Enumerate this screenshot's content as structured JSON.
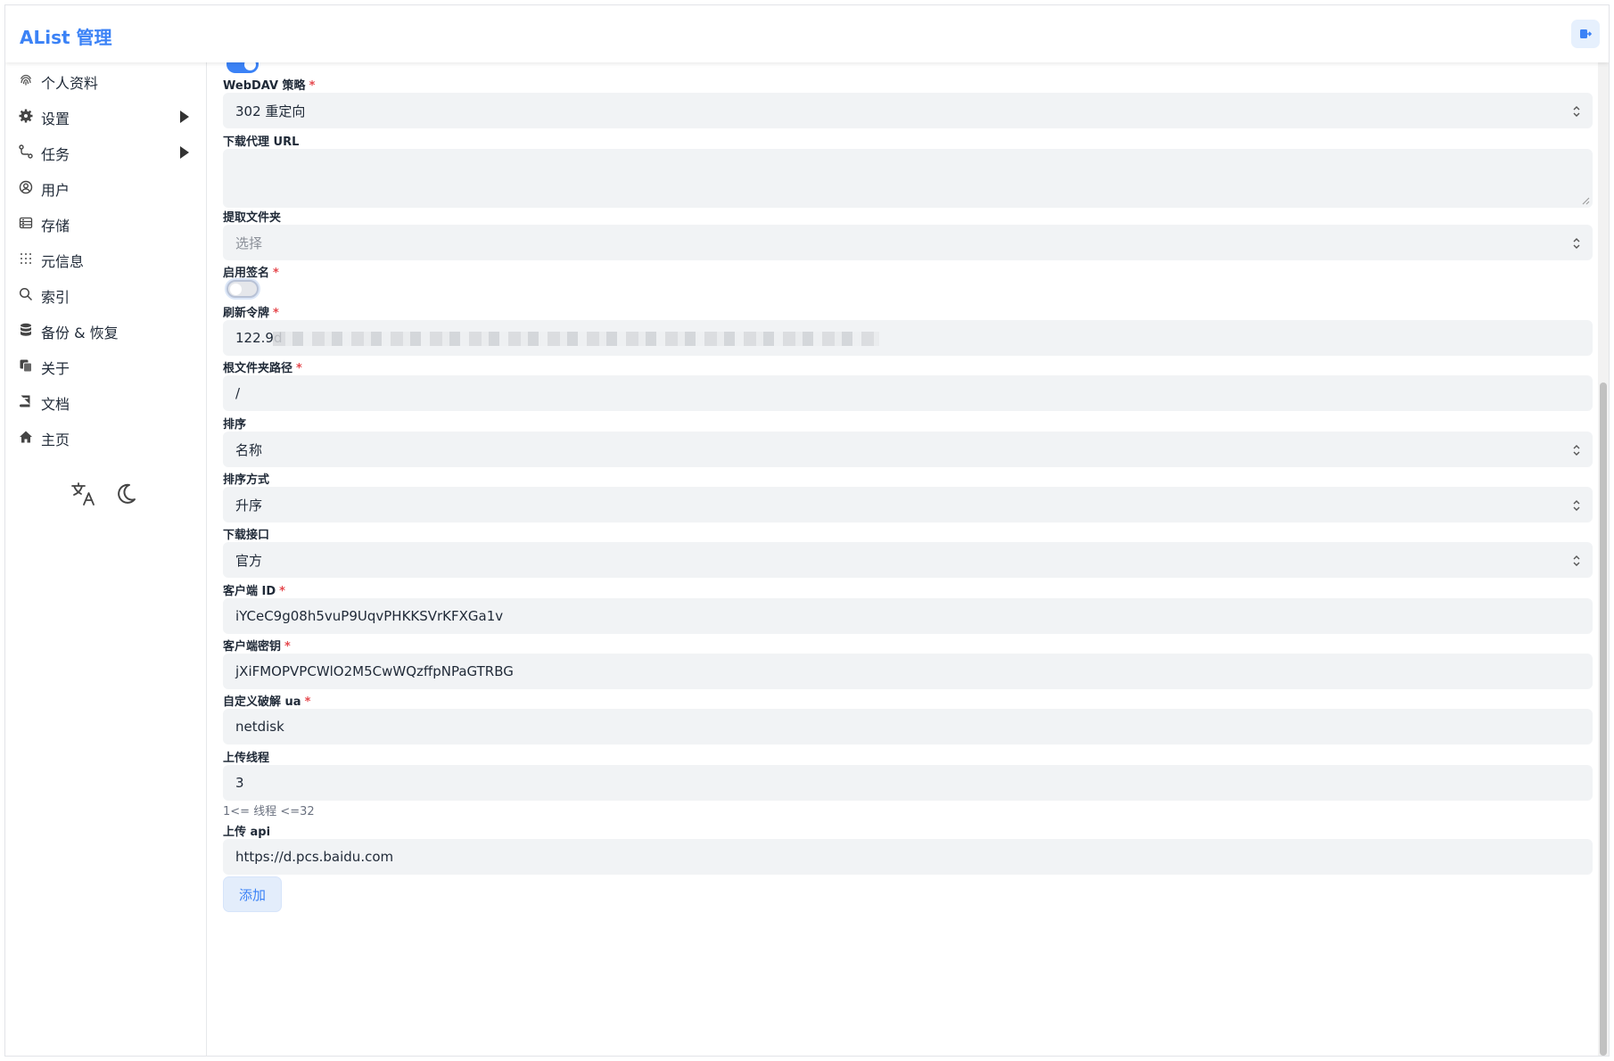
{
  "header": {
    "title": "AList 管理"
  },
  "sidebar": {
    "items": [
      {
        "label": "个人资料",
        "icon": "fingerprint-icon"
      },
      {
        "label": "设置",
        "icon": "gear-icon"
      },
      {
        "label": "任务",
        "icon": "route-icon"
      },
      {
        "label": "用户",
        "icon": "user-circle-icon"
      },
      {
        "label": "存储",
        "icon": "database-drive-icon"
      },
      {
        "label": "元信息",
        "icon": "metadata-icon"
      },
      {
        "label": "索引",
        "icon": "search-icon"
      },
      {
        "label": "备份 & 恢复",
        "icon": "database-icon"
      },
      {
        "label": "关于",
        "icon": "copy-icon"
      },
      {
        "label": "文档",
        "icon": "book-icon"
      },
      {
        "label": "主页",
        "icon": "home-icon"
      }
    ]
  },
  "form": {
    "webdav_policy": {
      "label": "WebDAV 策略",
      "required": "*",
      "value": "302 重定向"
    },
    "download_proxy_url": {
      "label": "下载代理 URL",
      "value": ""
    },
    "extract_folder": {
      "label": "提取文件夹",
      "placeholder": "选择"
    },
    "enable_sign": {
      "label": "启用签名",
      "required": "*"
    },
    "refresh_token": {
      "label": "刷新令牌",
      "required": "*",
      "value": "122.9d"
    },
    "root_folder_path": {
      "label": "根文件夹路径",
      "required": "*",
      "value": "/"
    },
    "order_by": {
      "label": "排序",
      "value": "名称"
    },
    "order_direction": {
      "label": "排序方式",
      "value": "升序"
    },
    "download_api": {
      "label": "下载接口",
      "value": "官方"
    },
    "client_id": {
      "label": "客户端 ID",
      "required": "*",
      "value": "iYCeC9g08h5vuP9UqvPHKKSVrKFXGa1v"
    },
    "client_secret": {
      "label": "客户端密钥",
      "required": "*",
      "value": "jXiFMOPVPCWlO2M5CwWQzffpNPaGTRBG"
    },
    "custom_crack_ua": {
      "label": "自定义破解 ua",
      "required": "*",
      "value": "netdisk"
    },
    "upload_thread": {
      "label": "上传线程",
      "value": "3",
      "help": "1<= 线程 <=32"
    },
    "upload_api": {
      "label": "上传 api",
      "value": "https://d.pcs.baidu.com"
    },
    "add_button": "添加"
  },
  "colors": {
    "accent": "#3b82f6",
    "required": "#e5484d",
    "input_bg": "#f1f3f5"
  }
}
